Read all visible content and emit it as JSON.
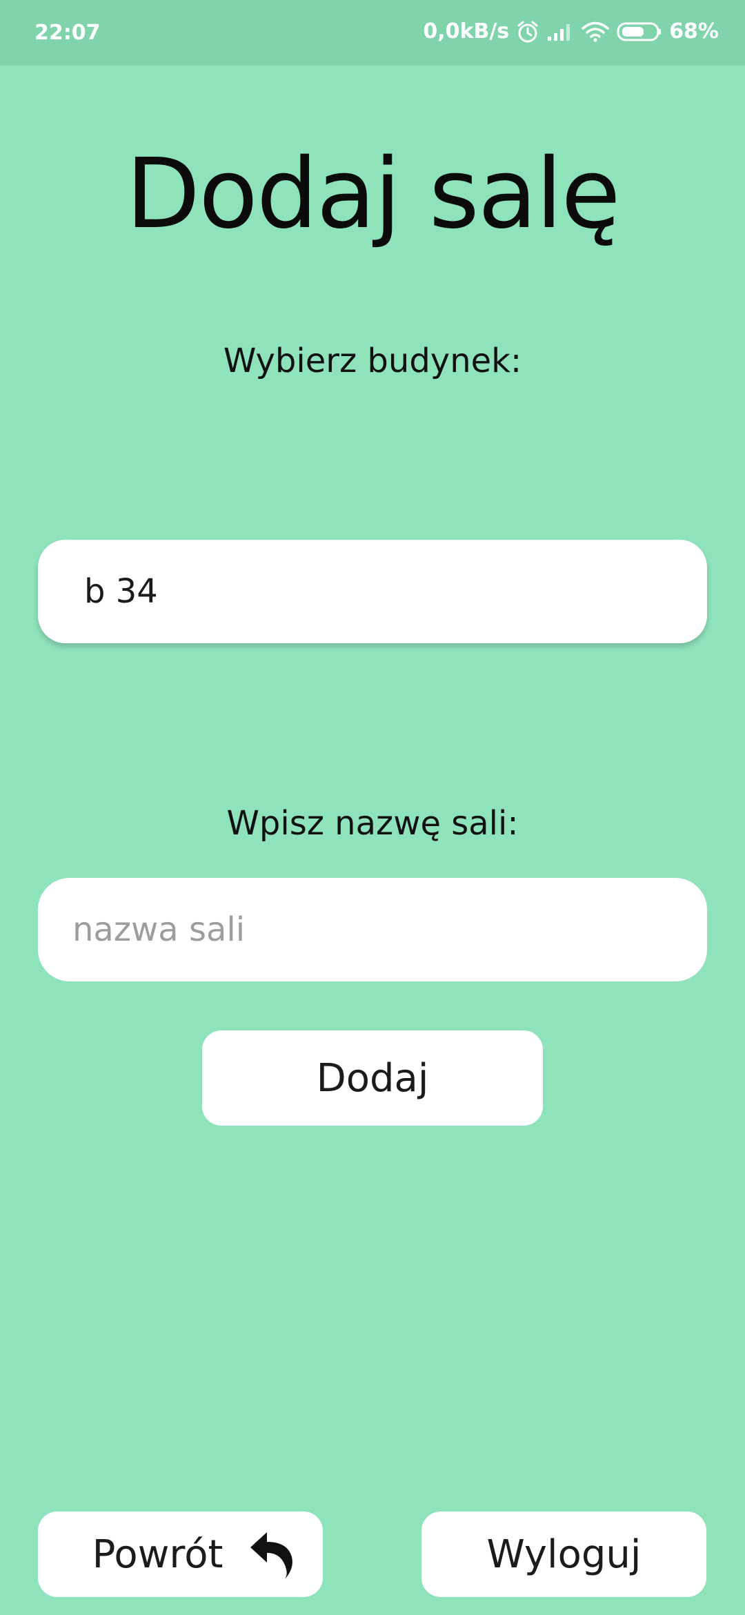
{
  "status_bar": {
    "time": "22:07",
    "network_speed": "0,0kB/s",
    "battery_percent": "68%",
    "battery_level": 0.68,
    "icons": [
      "alarm-icon",
      "signal-icon",
      "wifi-icon",
      "battery-icon"
    ]
  },
  "page": {
    "title": "Dodaj salę",
    "building_label": "Wybierz budynek:",
    "building_selected": "b 34",
    "room_label": "Wpisz nazwę sali:",
    "room_placeholder": "nazwa sali",
    "room_value": "",
    "add_button": "Dodaj"
  },
  "footer": {
    "back_button": "Powrót",
    "back_icon": "undo-arrow-icon",
    "logout_button": "Wyloguj"
  },
  "colors": {
    "background": "#8fe3bb",
    "status_bar": "#7fd4ab",
    "surface": "#ffffff"
  }
}
